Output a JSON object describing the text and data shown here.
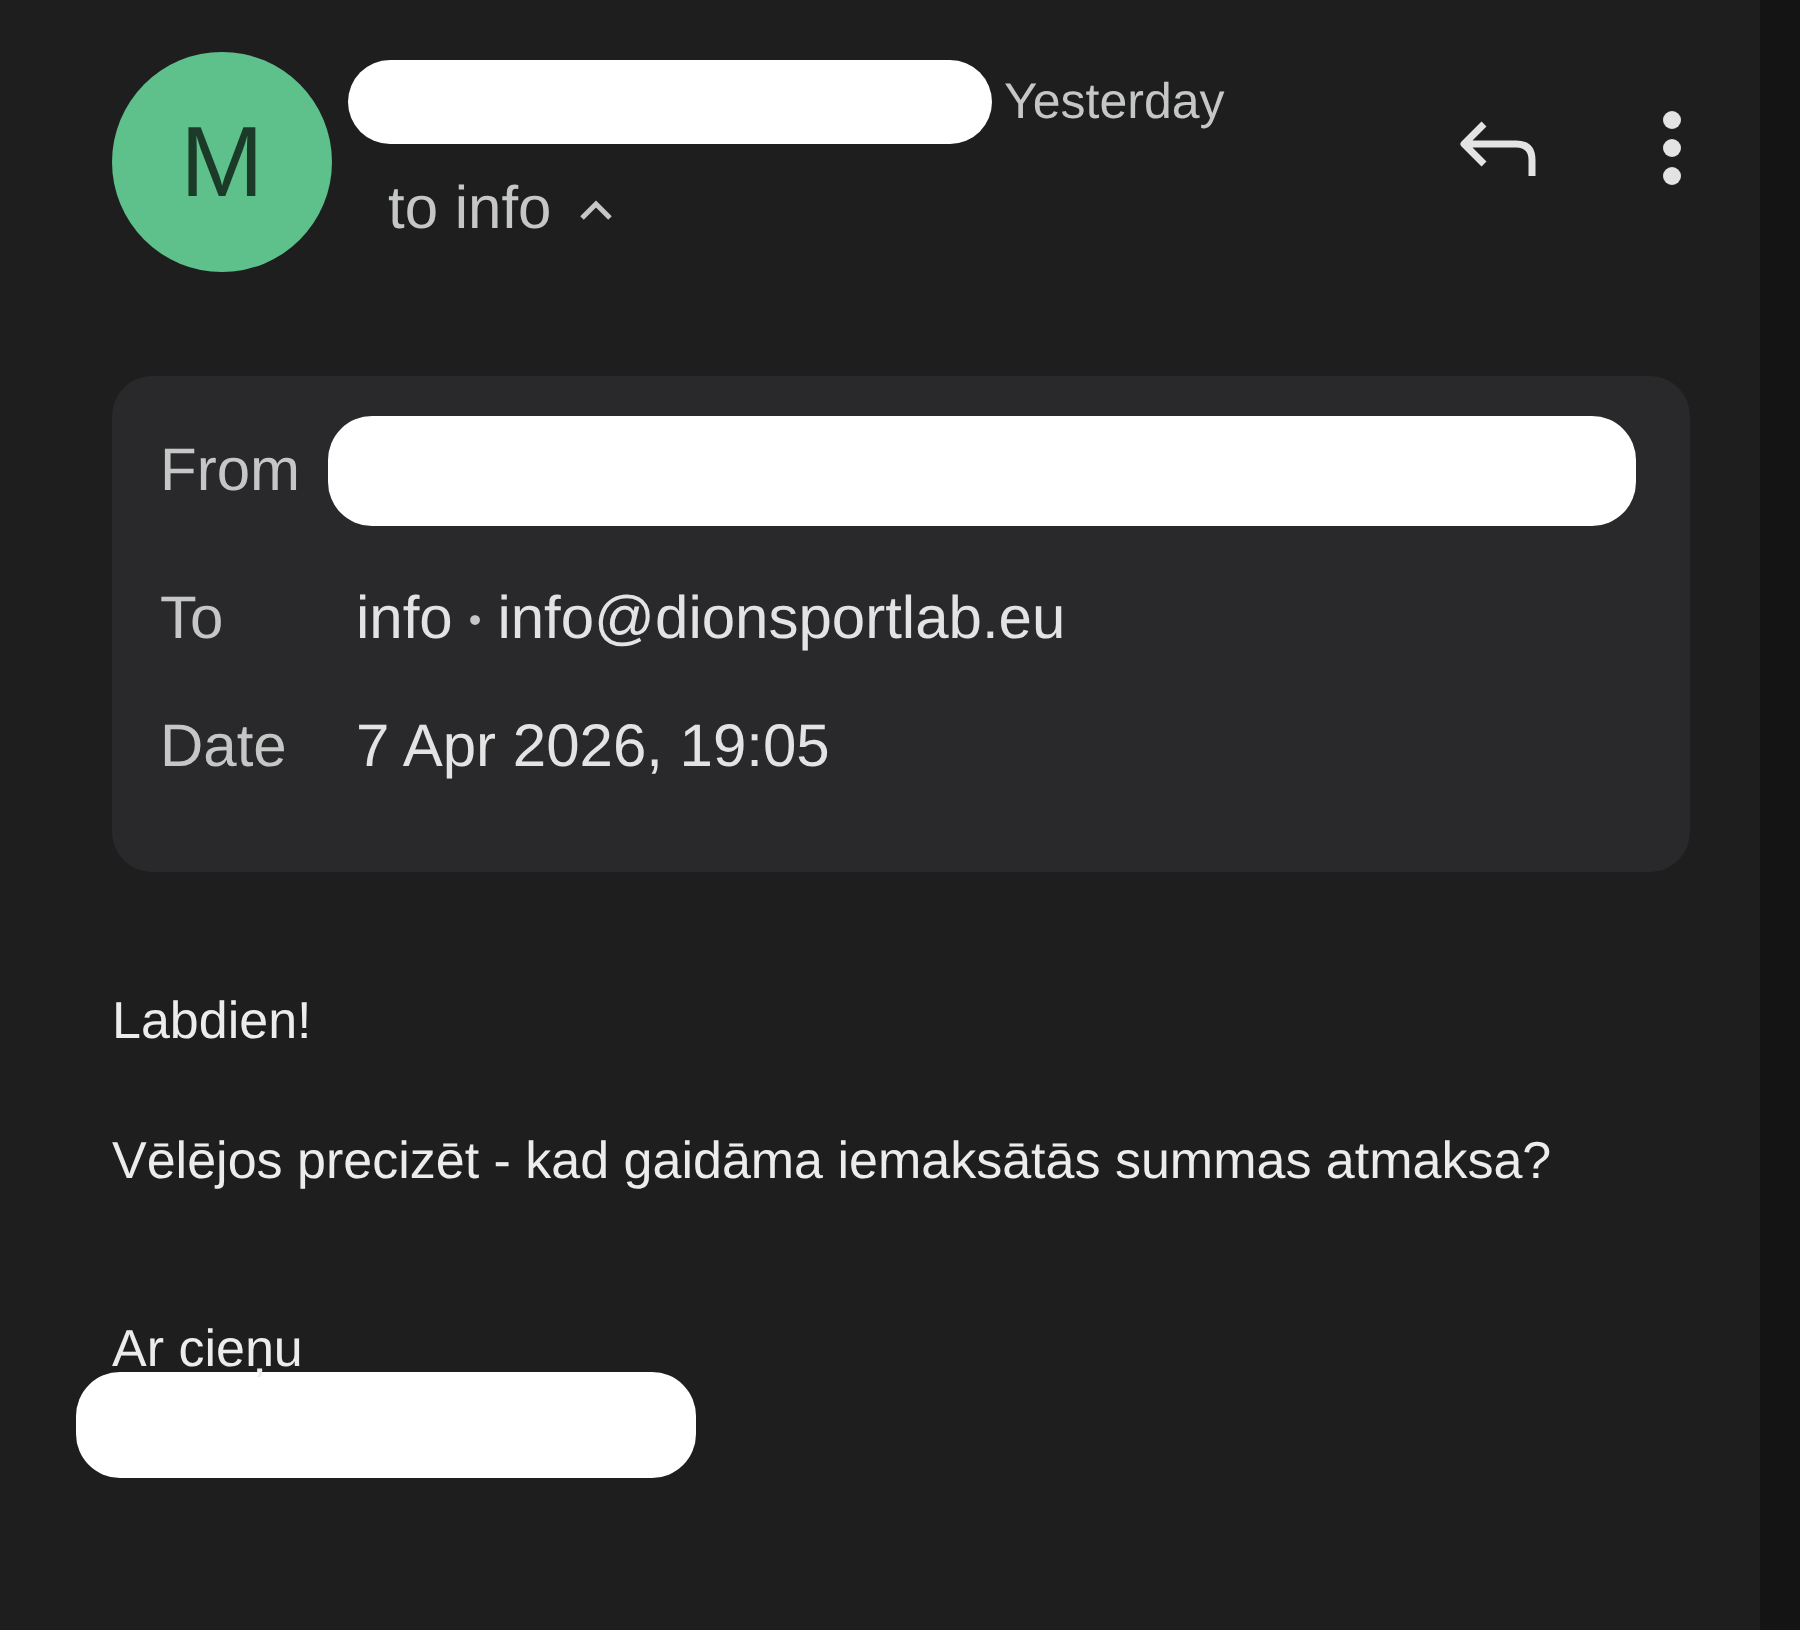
{
  "header": {
    "avatar_letter": "M",
    "time": "Yesterday",
    "recipients": "to info",
    "details_expanded": true
  },
  "details": [
    {
      "label": "From",
      "kind": "redacted"
    },
    {
      "label": "To",
      "kind": "address",
      "name": "info",
      "separator": "•",
      "email": "info@dionsportlab.eu"
    },
    {
      "label": "Date",
      "kind": "text",
      "value": "7 Apr 2026, 19:05"
    }
  ],
  "body": {
    "paragraphs": [
      "Labdien!",
      "Vēlējos precizēt - kad gaidāma iemaksātās summas atmaksa?"
    ],
    "closing": "Ar cieņu"
  }
}
